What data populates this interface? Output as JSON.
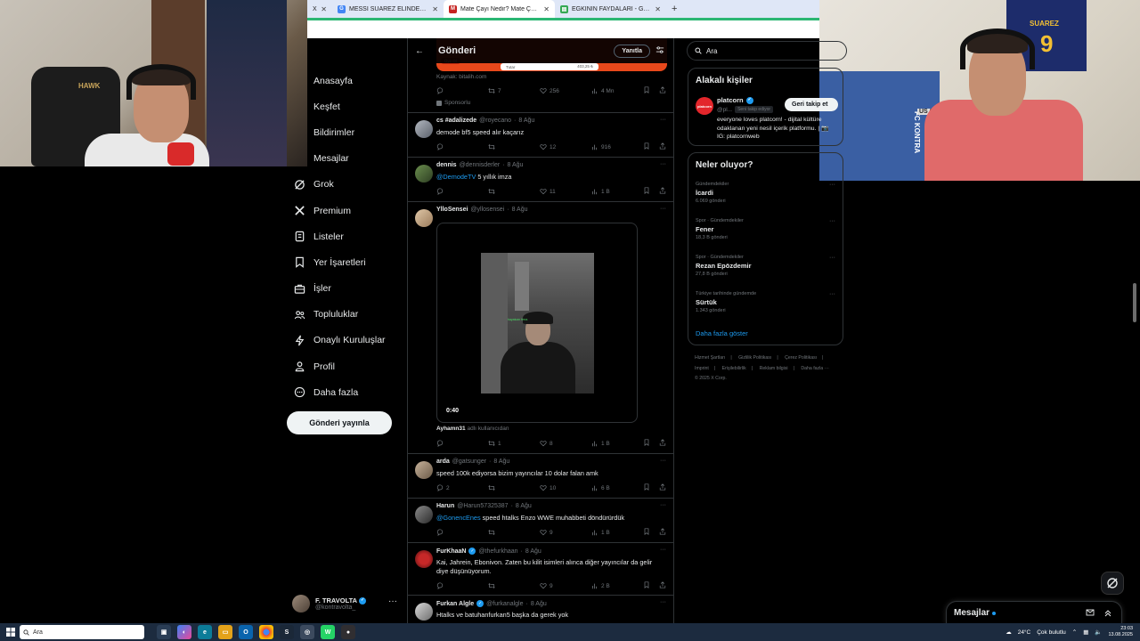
{
  "browser": {
    "tabs": [
      {
        "title": "X",
        "icon": "x-icon",
        "color": "#000000",
        "active": false
      },
      {
        "title": "MESSİ SUAREZ ELİNDEKİ MATE",
        "icon": "google-icon",
        "color": "#4285f4",
        "active": false
      },
      {
        "title": "Mate Çayı Nedir? Mate Çayı Fa",
        "icon": "gmail-icon",
        "color": "#c5221f",
        "active": true
      },
      {
        "title": "EĞKİNİN FAYDALARI - Google A",
        "icon": "docs-icon",
        "color": "#34a853",
        "active": false
      }
    ],
    "new_tab": "+"
  },
  "nav": {
    "items": [
      {
        "label": "Anasayfa",
        "icon": "home-icon"
      },
      {
        "label": "Keşfet",
        "icon": "search-icon"
      },
      {
        "label": "Bildirimler",
        "icon": "bell-icon"
      },
      {
        "label": "Mesajlar",
        "icon": "mail-icon"
      },
      {
        "label": "Grok",
        "icon": "grok-icon"
      },
      {
        "label": "Premium",
        "icon": "x-logo-icon"
      },
      {
        "label": "Listeler",
        "icon": "list-icon"
      },
      {
        "label": "Yer İşaretleri",
        "icon": "bookmark-icon"
      },
      {
        "label": "İşler",
        "icon": "briefcase-icon"
      },
      {
        "label": "Topluluklar",
        "icon": "communities-icon"
      },
      {
        "label": "Onaylı Kuruluşlar",
        "icon": "lightning-icon"
      },
      {
        "label": "Profil",
        "icon": "person-icon"
      },
      {
        "label": "Daha fazla",
        "icon": "more-circle-icon"
      }
    ],
    "post_button": "Gönderi yayınla",
    "account": {
      "name": "F. TRAVOLTA",
      "handle": "@kontravolta_",
      "more": "···"
    }
  },
  "center": {
    "header": {
      "title": "Gönderi",
      "reply_button": "Yanıtla"
    },
    "ad": {
      "pill": "Üye Ol",
      "inner_left": "Tutar",
      "inner_right": "403,25 ₺",
      "source": "Kaynak: bitalih.com",
      "stats": {
        "retweets": "7",
        "likes": "256",
        "views": "4 Mn"
      },
      "sponsored": "Sponsorlu"
    },
    "posts": [
      {
        "name": "cs #adalizede",
        "handle": "@royecano",
        "date": "8 Ağu",
        "text": "demode bf5 speed alır kaçarız",
        "mention": "",
        "replies": "",
        "retweets": "",
        "likes": "12",
        "views": "916"
      },
      {
        "name": "dennis",
        "handle": "@dennisderler",
        "date": "8 Ağu",
        "text": "5 yıllık imza",
        "mention": "@DemodeTV",
        "replies": "",
        "retweets": "",
        "likes": "11",
        "views": "1 B"
      },
      {
        "name": "YlloSensei",
        "handle": "@yllosensei",
        "date": "8 Ağu",
        "text": "",
        "mention": "",
        "replies": "",
        "retweets": "1",
        "likes": "8",
        "views": "1 B",
        "video_duration": "0:40",
        "video_overlay": "hayatcan ferra",
        "caption_user": "Ayhamn31",
        "caption_rest": "adlı kullanıcıdan"
      },
      {
        "name": "arda",
        "handle": "@gatsunger",
        "date": "8 Ağu",
        "text": "speed 100k ediyorsa bizim yayıncılar 10 dolar falan amk",
        "mention": "",
        "replies": "2",
        "retweets": "",
        "likes": "10",
        "views": "6 B"
      },
      {
        "name": "Harun",
        "handle": "@Harun57325387",
        "date": "8 Ağu",
        "text": "speed htalks Enzo WWE muhabbeti döndürürdük",
        "mention": "@GonencEnes",
        "replies": "",
        "retweets": "",
        "likes": "9",
        "views": "1 B"
      },
      {
        "name": "FurKhaaN",
        "handle": "@thefurkhaan",
        "date": "8 Ağu",
        "text": "Kai, Jahrein, Ebonivon. Zaten bu kilit isimleri alınca diğer yayıncılar da gelir diye düşünüyorum.",
        "mention": "",
        "replies": "",
        "retweets": "",
        "likes": "9",
        "views": "2 B",
        "verified": true
      },
      {
        "name": "Furkan Algle",
        "handle": "@furkanalgle",
        "date": "8 Ağu",
        "text": "Htalks ve batuhanfurkan5 başka da gerek yok",
        "mention": "",
        "verified": true
      }
    ],
    "more": "···"
  },
  "right": {
    "search_placeholder": "Ara",
    "relevant": {
      "title": "Alakalı kişiler",
      "name": "platcorn",
      "handle": "@pl...",
      "follows_you": "Seni takip ediyor",
      "follow_button": "Geri takip et",
      "bio": "everyone loves platcorn! - dijital kültüre odaklanan yeni nesil içerik platformu. | 📷 IG: platcornweb",
      "avatar_text": "platcorn"
    },
    "trends": {
      "title": "Neler oluyor?",
      "items": [
        {
          "category": "Gündemdekiler",
          "name": "İcardi",
          "count": "6.069 gönderi"
        },
        {
          "category": "Spor · Gündemdekiler",
          "name": "Fener",
          "count": "18,3 B gönderi"
        },
        {
          "category": "Spor · Gündemdekiler",
          "name": "Rezan Epözdemir",
          "count": "27,8 B gönderi"
        },
        {
          "category": "Türkiye tarihinde gündemde",
          "name": "Sürtük",
          "count": "1.343 gönderi"
        }
      ],
      "show_more": "Daha fazla göster"
    },
    "footer": [
      "Hizmet Şartları",
      "|",
      "Gizlilik Politikası",
      "|",
      "Çerez Politikası",
      "|",
      "Imprint",
      "|",
      "Erişilebilirlik",
      "|",
      "Reklam bilgisi",
      "|",
      "Daha fazla ···",
      "© 2025 X Corp."
    ]
  },
  "drawer": {
    "title": "Mesajlar"
  },
  "cams": {
    "left_chair_text": "HAWK",
    "right_jersey_name": "SUAREZ",
    "right_jersey_number": "9",
    "right_flag_text": "FC KONTRA",
    "right_sign": "US 0971"
  },
  "taskbar": {
    "search": "Ara",
    "weather": "24°C",
    "weather_text": "Çok bulutlu",
    "time": "23:03",
    "date": "13.08.2025"
  }
}
